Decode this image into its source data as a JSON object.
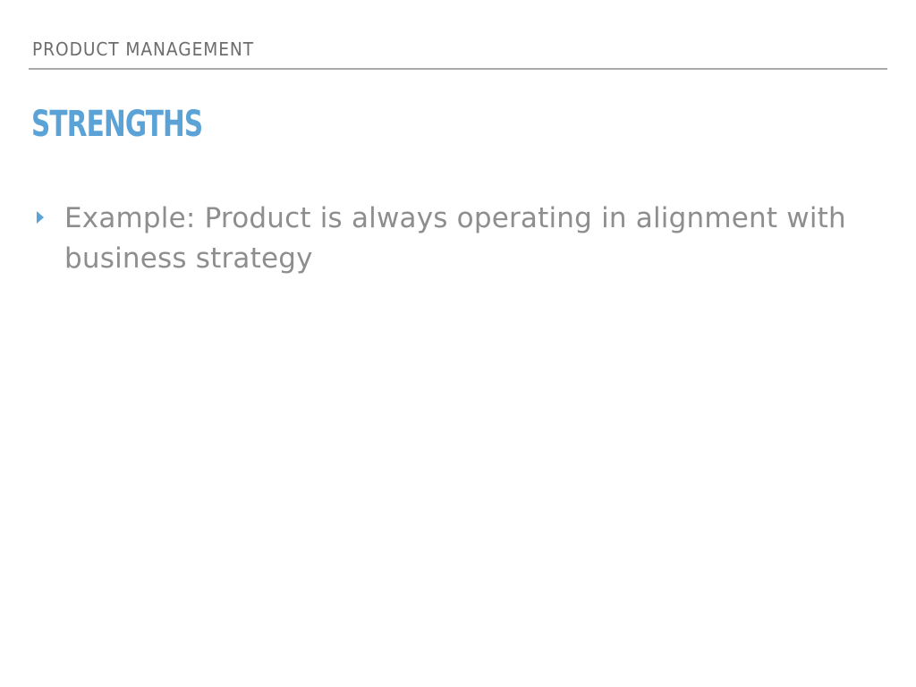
{
  "header": {
    "label": "PRODUCT MANAGEMENT"
  },
  "slide": {
    "title": "STRENGTHS",
    "bullets": [
      {
        "text": "Example: Product is always operating in alignment with business strategy"
      }
    ]
  },
  "colors": {
    "title": "#5ba3d6",
    "bullet_marker": "#5ba3d6",
    "header_text": "#6d6d6d",
    "body_text": "#8e8e8e",
    "rule": "#a9a9a9",
    "background": "#ffffff"
  },
  "icons": {
    "bullet": "triangle-right-icon"
  }
}
